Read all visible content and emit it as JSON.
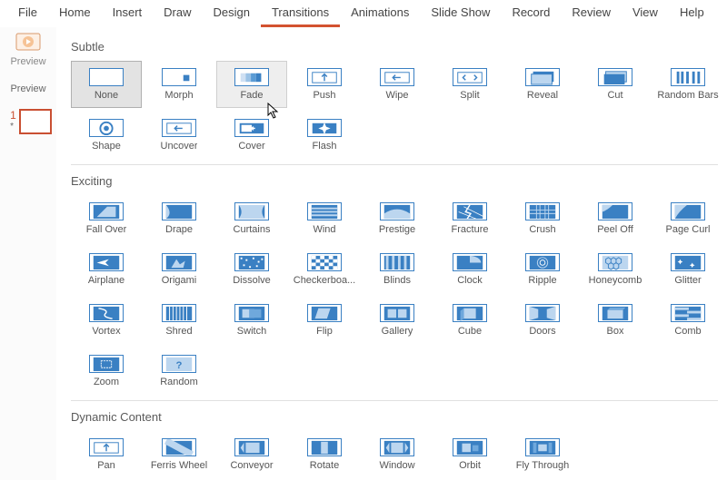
{
  "ribbon": {
    "tabs": [
      "File",
      "Home",
      "Insert",
      "Draw",
      "Design",
      "Transitions",
      "Animations",
      "Slide Show",
      "Record",
      "Review",
      "View",
      "Help"
    ],
    "active": "Transitions"
  },
  "preview": {
    "button_label": "Preview",
    "section_label": "Preview"
  },
  "slides": {
    "number": "1",
    "star": "*"
  },
  "gallery": {
    "groups": [
      {
        "title": "Subtle",
        "items": [
          "None",
          "Morph",
          "Fade",
          "Push",
          "Wipe",
          "Split",
          "Reveal",
          "Cut",
          "Random Bars",
          "Shape",
          "Uncover",
          "Cover",
          "Flash"
        ],
        "selected": "None",
        "hovered": "Fade"
      },
      {
        "title": "Exciting",
        "items": [
          "Fall Over",
          "Drape",
          "Curtains",
          "Wind",
          "Prestige",
          "Fracture",
          "Crush",
          "Peel Off",
          "Page Curl",
          "Airplane",
          "Origami",
          "Dissolve",
          "Checkerboa...",
          "Blinds",
          "Clock",
          "Ripple",
          "Honeycomb",
          "Glitter",
          "Vortex",
          "Shred",
          "Switch",
          "Flip",
          "Gallery",
          "Cube",
          "Doors",
          "Box",
          "Comb",
          "Zoom",
          "Random"
        ]
      },
      {
        "title": "Dynamic Content",
        "items": [
          "Pan",
          "Ferris Wheel",
          "Conveyor",
          "Rotate",
          "Window",
          "Orbit",
          "Fly Through"
        ]
      }
    ]
  },
  "icons": {
    "None": "<svg viewBox='0 0 38 20'></svg>",
    "Morph": "<svg viewBox='0 0 38 20'><rect x='24' y='7' width='7' height='7' fill='#3a80c3'/></svg>",
    "Fade": "<svg viewBox='0 0 38 20'><rect x='6' y='5' width='6' height='10' fill='#cfe0f3'/><rect x='12' y='5' width='6' height='10' fill='#9bc2e6'/><rect x='18' y='5' width='6' height='10' fill='#5a9bd4'/><rect x='24' y='5' width='6' height='10' fill='#3a80c3'/></svg>",
    "Push": "<svg viewBox='0 0 38 20'><rect x='5' y='4' width='28' height='12' fill='none' stroke='#3a80c3'/><path d='M19 6v8M16 9l3-3 3 3' fill='none' stroke='#3a80c3' stroke-width='1.5'/></svg>",
    "Wipe": "<svg viewBox='0 0 38 20'><rect x='5' y='4' width='28' height='12' fill='none' stroke='#3a80c3'/><path d='M23 10h-8M17 7l-3 3 3 3' fill='none' stroke='#3a80c3' stroke-width='1.5'/></svg>",
    "Split": "<svg viewBox='0 0 38 20'><rect x='5' y='4' width='28' height='12' fill='none' stroke='#3a80c3'/><path d='M14 7l-3 3 3 3M24 7l3 3-3 3' fill='none' stroke='#3a80c3' stroke-width='1.5'/></svg>",
    "Reveal": "<svg viewBox='0 0 38 20'><rect x='8' y='3' width='24' height='12' fill='#3a80c3'/><rect x='6' y='6' width='24' height='12' fill='#bcd6ef' stroke='#3a80c3'/></svg>",
    "Cut": "<svg viewBox='0 0 38 20'><rect x='8' y='3' width='24' height='12' fill='#bcd6ef' stroke='#3a80c3'/><rect x='6' y='6' width='24' height='12' fill='#3a80c3'/></svg>",
    "Random Bars": "<svg viewBox='0 0 38 20'><rect x='6' y='3' width='3' height='14' fill='#3a80c3'/><rect x='11' y='3' width='3' height='14' fill='#3a80c3'/><rect x='17' y='3' width='3' height='14' fill='#3a80c3'/><rect x='24' y='3' width='3' height='14' fill='#3a80c3'/><rect x='30' y='3' width='3' height='14' fill='#3a80c3'/></svg>",
    "Shape": "<svg viewBox='0 0 38 20'><circle cx='19' cy='10' r='7' fill='none' stroke='#3a80c3' stroke-width='2'/><circle cx='19' cy='10' r='3' fill='#3a80c3'/></svg>",
    "Uncover": "<svg viewBox='0 0 38 20'><rect x='5' y='4' width='28' height='12' fill='none' stroke='#3a80c3'/><path d='M23 10h-8M17 7l-3 3 3 3' fill='none' stroke='#3a80c3' stroke-width='1.5'/></svg>",
    "Cover": "<svg viewBox='0 0 38 20'><rect x='5' y='4' width='28' height='12' fill='#3a80c3'/><rect x='7' y='6' width='12' height='8' fill='#fff'/><path d='M23 10h-4M21 8l-2 2 2 2' fill='none' stroke='#fff' stroke-width='1.5'/></svg>",
    "Flash": "<svg viewBox='0 0 38 20'><rect x='5' y='4' width='28' height='12' fill='#3a80c3'/><path d='M19 3l2 5 5 2-5 2-2 5-2-5-5-2 5-2z' fill='#fff'/></svg>",
    "Fall Over": "<svg viewBox='0 0 38 20'><rect x='4' y='2' width='30' height='16' fill='#3a80c3'/><path d='M8 16 L20 4 L30 4 L30 16 Z' fill='#bcd6ef'/></svg>",
    "Drape": "<svg viewBox='0 0 38 20'><rect x='4' y='2' width='30' height='16' fill='#3a80c3'/><path d='M4 2 Q12 12 4 18 Z' fill='#bcd6ef'/></svg>",
    "Curtains": "<svg viewBox='0 0 38 20'><rect x='4' y='2' width='30' height='16' fill='#bcd6ef'/><path d='M4 2 Q10 10 4 18' fill='#3a80c3'/><path d='M34 2 Q28 10 34 18' fill='#3a80c3'/></svg>",
    "Wind": "<svg viewBox='0 0 38 20'><rect x='4' y='2' width='30' height='16' fill='#3a80c3'/><path d='M4 6h30M4 10h30M4 14h30' stroke='#bcd6ef' stroke-width='2'/></svg>",
    "Prestige": "<svg viewBox='0 0 38 20'><rect x='4' y='2' width='30' height='16' fill='#3a80c3'/><path d='M4 12 Q19 2 34 12 L34 18 L4 18 Z' fill='#bcd6ef'/></svg>",
    "Fracture": "<svg viewBox='0 0 38 20'><rect x='4' y='2' width='30' height='16' fill='#3a80c3'/><path d='M19 2l-5 8 6 2-4 6' fill='none' stroke='#fff' stroke-width='1.5'/><path d='M12 4l24 12M6 10l20 8' stroke='#fff' stroke-width='0.8'/></svg>",
    "Crush": "<svg viewBox='0 0 38 20'><rect x='4' y='2' width='30' height='16' fill='#3a80c3'/><path d='M12 2v16M16 2v16M22 2v16M26 2v16' stroke='#bcd6ef' stroke-width='1'/><path d='M4 8h30M4 12h30' stroke='#bcd6ef' stroke-width='1'/></svg>",
    "Peel Off": "<svg viewBox='0 0 38 20'><rect x='4' y='2' width='30' height='16' fill='#3a80c3'/><path d='M4 2 L16 2 Q10 8 4 10 Z' fill='#bcd6ef'/></svg>",
    "Page Curl": "<svg viewBox='0 0 38 20'><rect x='4' y='2' width='30' height='16' fill='#3a80c3'/><path d='M4 2 L18 2 Q8 10 4 18 Z' fill='#bcd6ef'/></svg>",
    "Airplane": "<svg viewBox='0 0 38 20'><rect x='4' y='2' width='30' height='16' fill='#3a80c3'/><path d='M8 10l14-4-4 4 4 4z' fill='#fff'/></svg>",
    "Origami": "<svg viewBox='0 0 38 20'><rect x='4' y='2' width='30' height='16' fill='#3a80c3'/><path d='M10 16l6-10 4 6 6-4-2 8z' fill='#bcd6ef'/></svg>",
    "Dissolve": "<svg viewBox='0 0 38 20'><rect x='4' y='2' width='30' height='16' fill='#3a80c3'/><g fill='#fff'><rect x='6' y='4' width='2' height='2'/><rect x='12' y='6' width='2' height='2'/><rect x='20' y='4' width='2' height='2'/><rect x='26' y='8' width='2' height='2'/><rect x='9' y='12' width='2' height='2'/><rect x='16' y='14' width='2' height='2'/><rect x='24' y='13' width='2' height='2'/><rect x='30' y='5' width='2' height='2'/></g></svg>",
    "Checkerboa...": "<svg viewBox='0 0 38 20'><rect x='4' y='2' width='30' height='16' fill='#3a80c3'/><g fill='#fff'><rect x='4' y='2' width='5' height='4'/><rect x='14' y='2' width='5' height='4'/><rect x='24' y='2' width='5' height='4'/><rect x='9' y='6' width='5' height='4'/><rect x='19' y='6' width='5' height='4'/><rect x='29' y='6' width='5' height='4'/><rect x='4' y='10' width='5' height='4'/><rect x='14' y='10' width='5' height='4'/><rect x='24' y='10' width='5' height='4'/><rect x='9' y='14' width='5' height='4'/><rect x='19' y='14' width='5' height='4'/><rect x='29' y='14' width='5' height='4'/></g></svg>",
    "Blinds": "<svg viewBox='0 0 38 20'><rect x='4' y='2' width='30' height='16' fill='#3a80c3'/><g fill='#bcd6ef'><rect x='6' y='2' width='3' height='16'/><rect x='13' y='2' width='3' height='16'/><rect x='20' y='2' width='3' height='16'/><rect x='27' y='2' width='3' height='16'/></g></svg>",
    "Clock": "<svg viewBox='0 0 38 20'><rect x='4' y='2' width='30' height='16' fill='#3a80c3'/><path d='M19 10 L19 2 A14 8 0 0 1 32 10 Z' fill='#bcd6ef'/></svg>",
    "Ripple": "<svg viewBox='0 0 38 20'><rect x='4' y='2' width='30' height='16' fill='#3a80c3'/><circle cx='19' cy='10' r='3' fill='none' stroke='#fff'/><circle cx='19' cy='10' r='6' fill='none' stroke='#bcd6ef'/></svg>",
    "Honeycomb": "<svg viewBox='0 0 38 20'><rect x='4' y='2' width='30' height='16' fill='#bcd6ef'/><g fill='none' stroke='#3a80c3'><path d='M8 6l3-2 3 2v4l-3 2-3-2zM14 6l3-2 3 2v4l-3 2-3-2zM20 6l3-2 3 2v4l-3 2-3-2zM11 12l3-2 3 2v4l-3 2-3-2zM17 12l3-2 3 2v4l-3 2-3-2z'/></g></svg>",
    "Glitter": "<svg viewBox='0 0 38 20'><rect x='4' y='2' width='30' height='16' fill='#3a80c3'/><g fill='#fff'><path d='M10 6l1 2 2 1-2 1-1 2-1-2-2-1 2-1z'/><path d='M24 10l1 2 2 1-2 1-1 2-1-2-2-1 2-1z'/></g></svg>",
    "Vortex": "<svg viewBox='0 0 38 20'><rect x='4' y='2' width='30' height='16' fill='#3a80c3'/><path d='M10 4 Q22 6 18 10 Q14 14 26 16' fill='none' stroke='#fff' stroke-width='1.5'/></svg>",
    "Shred": "<svg viewBox='0 0 38 20'><rect x='4' y='2' width='30' height='16' fill='#3a80c3'/><g stroke='#fff' stroke-width='1'><path d='M8 2v16M12 2v16M16 2v16M20 2v16M24 2v16M28 2v16'/></g></svg>",
    "Switch": "<svg viewBox='0 0 38 20'><rect x='4' y='2' width='30' height='16' fill='#3a80c3'/><rect x='8' y='5' width='14' height='10' fill='#bcd6ef'/><rect x='16' y='5' width='14' height='10' fill='#6fa8dc'/></svg>",
    "Flip": "<svg viewBox='0 0 38 20'><rect x='4' y='2' width='30' height='16' fill='#3a80c3'/><path d='M12 4l14 0-4 12-14 0z' fill='#bcd6ef'/></svg>",
    "Gallery": "<svg viewBox='0 0 38 20'><rect x='4' y='2' width='30' height='16' fill='#3a80c3'/><rect x='8' y='5' width='10' height='10' fill='#bcd6ef'/><rect x='20' y='5' width='10' height='10' fill='#bcd6ef'/></svg>",
    "Cube": "<svg viewBox='0 0 38 20'><rect x='4' y='2' width='30' height='16' fill='#3a80c3'/><path d='M12 4h14v12h-14z' fill='#bcd6ef'/><path d='M12 4l-4 3v12l4-3' fill='#6fa8dc'/></svg>",
    "Doors": "<svg viewBox='0 0 38 20'><rect x='4' y='2' width='30' height='16' fill='#3a80c3'/><path d='M4 2l10 3v10l-10 3z' fill='#bcd6ef'/><path d='M34 2l-10 3v10l10 3z' fill='#bcd6ef'/></svg>",
    "Box": "<svg viewBox='0 0 38 20'><rect x='4' y='2' width='30' height='16' fill='#3a80c3'/><path d='M10 6h18v10h-18z' fill='#bcd6ef'/><path d='M10 6l3-3h18l-3 3' fill='#6fa8dc'/></svg>",
    "Comb": "<svg viewBox='0 0 38 20'><rect x='4' y='2' width='30' height='16' fill='#3a80c3'/><g fill='#bcd6ef'><rect x='4' y='3' width='16' height='3'/><rect x='18' y='7' width='16' height='3'/><rect x='4' y='11' width='16' height='3'/><rect x='18' y='15' width='16' height='3'/></g></svg>",
    "Zoom": "<svg viewBox='0 0 38 20'><rect x='4' y='2' width='30' height='16' fill='#3a80c3'/><rect x='13' y='6' width='12' height='8' fill='none' stroke='#fff' stroke-dasharray='2 1'/></svg>",
    "Random": "<svg viewBox='0 0 38 20'><rect x='4' y='2' width='30' height='16' fill='#bcd6ef'/><text x='19' y='15' font-size='12' text-anchor='middle' fill='#3a80c3' font-weight='bold'>?</text></svg>",
    "Pan": "<svg viewBox='0 0 38 20'><rect x='5' y='4' width='28' height='12' fill='none' stroke='#3a80c3'/><path d='M19 6v8M16 9l3-3 3 3' fill='none' stroke='#3a80c3' stroke-width='1.5'/></svg>",
    "Ferris Wheel": "<svg viewBox='0 0 38 20'><rect x='4' y='2' width='30' height='16' fill='#3a80c3'/><path d='M4 2 L34 18' stroke='#bcd6ef' stroke-width='8'/></svg>",
    "Conveyor": "<svg viewBox='0 0 38 20'><rect x='4' y='2' width='30' height='16' fill='#3a80c3'/><path d='M10 4l-4 6 4 6' fill='#bcd6ef'/><rect x='12' y='4' width='16' height='12' fill='#bcd6ef'/></svg>",
    "Rotate": "<svg viewBox='0 0 38 20'><rect x='4' y='2' width='30' height='16' fill='#3a80c3'/><rect x='15' y='3' width='8' height='14' fill='#bcd6ef'/></svg>",
    "Window": "<svg viewBox='0 0 38 20'><rect x='4' y='2' width='30' height='16' fill='#3a80c3'/><path d='M10 4l-4 6 4 6' fill='#bcd6ef'/><path d='M28 4l4 6-4 6' fill='#bcd6ef'/><rect x='12' y='4' width='14' height='12' fill='#bcd6ef'/></svg>",
    "Orbit": "<svg viewBox='0 0 38 20'><rect x='4' y='2' width='30' height='16' fill='#3a80c3'/><rect x='10' y='5' width='10' height='10' fill='#bcd6ef'/><rect x='22' y='7' width='7' height='7' fill='#6fa8dc'/></svg>",
    "Fly Through": "<svg viewBox='0 0 38 20'><rect x='4' y='2' width='30' height='16' fill='#3a80c3'/><rect x='14' y='6' width='10' height='8' fill='#bcd6ef'/><rect x='8' y='4' width='4' height='12' fill='#6fa8dc'/><rect x='26' y='4' width='4' height='12' fill='#6fa8dc'/></svg>"
  }
}
